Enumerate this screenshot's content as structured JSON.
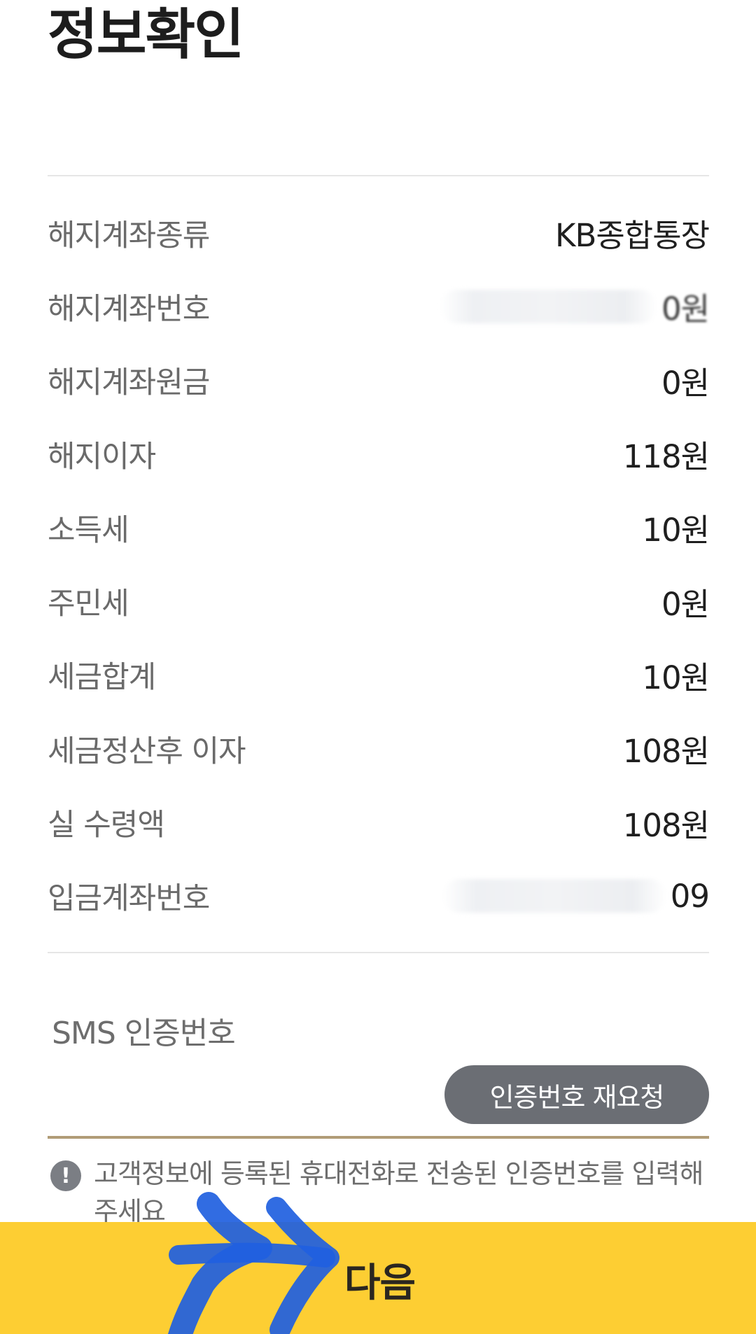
{
  "page": {
    "title": "정보확인"
  },
  "details": [
    {
      "label": "해지계좌종류",
      "value": "KB종합통장"
    },
    {
      "label": "해지계좌번호",
      "value": "0원",
      "masked": true
    },
    {
      "label": "해지계좌원금",
      "value": "0원"
    },
    {
      "label": "해지이자",
      "value": "118원"
    },
    {
      "label": "소득세",
      "value": "10원"
    },
    {
      "label": "주민세",
      "value": "0원"
    },
    {
      "label": "세금합계",
      "value": "10원"
    },
    {
      "label": "세금정산후 이자",
      "value": "108원"
    },
    {
      "label": "실 수령액",
      "value": "108원"
    },
    {
      "label": "입금계좌번호",
      "value": "09",
      "masked": true
    }
  ],
  "sms": {
    "label": "SMS 인증번호",
    "input_value": "",
    "resend_label": "인증번호 재요청"
  },
  "notice": {
    "icon": "exclamation-icon",
    "text": "고객정보에 등록된 휴대전화로 전송된 인증번호를 입력해 주세요"
  },
  "footer": {
    "next_label": "다음",
    "background_color": "#fdce33"
  },
  "annotation": {
    "icon": "blue-hand-drawn-arrow-icon",
    "color": "#1f5fe0"
  },
  "colors": {
    "accent_underline": "#b19c77",
    "button_gray": "#6b6e74"
  }
}
